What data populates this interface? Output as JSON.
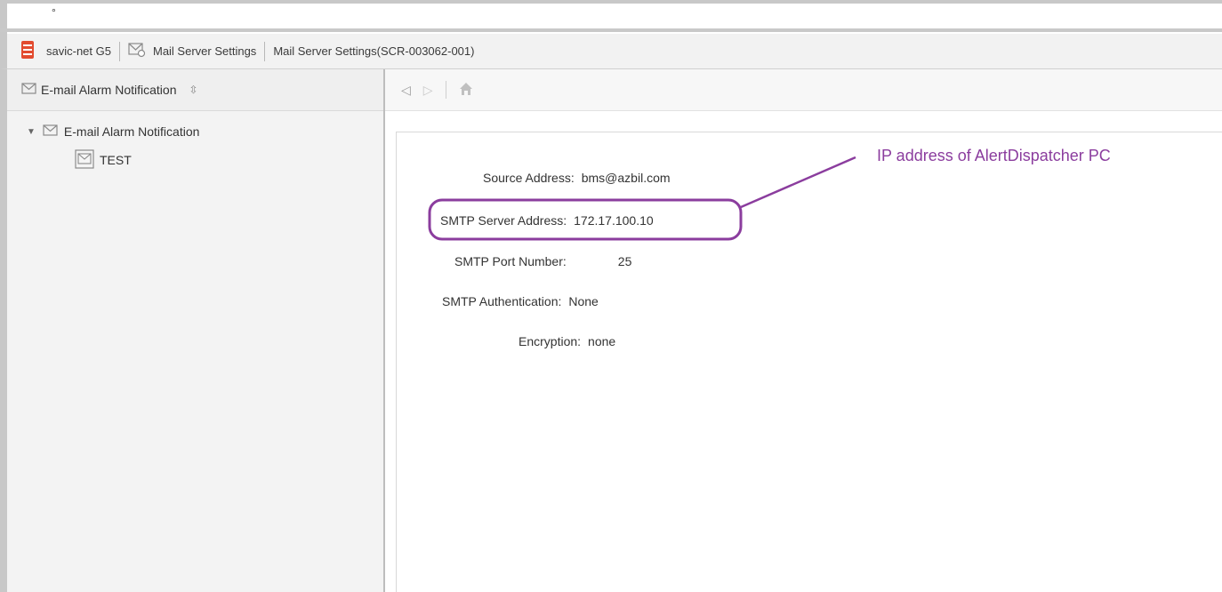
{
  "top_strip": {
    "marker": "°"
  },
  "breadcrumb": {
    "items": [
      {
        "label": "savic-net G5",
        "icon": "database-icon"
      },
      {
        "label": "Mail Server Settings",
        "icon": "mail-settings-icon"
      },
      {
        "label": "Mail Server Settings(SCR-003062-001)"
      }
    ]
  },
  "sidebar": {
    "header": "E-mail Alarm Notification",
    "tree": {
      "root": "E-mail Alarm Notification",
      "children": [
        "TEST"
      ]
    }
  },
  "form": {
    "source_address": {
      "label": "Source Address:",
      "value": "bms@azbil.com"
    },
    "smtp_server": {
      "label": "SMTP Server Address:",
      "value": "172.17.100.10"
    },
    "smtp_port": {
      "label": "SMTP Port Number:",
      "value": "25"
    },
    "smtp_auth": {
      "label": "SMTP Authentication:",
      "value": "None"
    },
    "encryption": {
      "label": "Encryption:",
      "value": "none"
    }
  },
  "annotation": {
    "text": "IP address of AlertDispatcher PC",
    "color": "#8b3d9e"
  }
}
